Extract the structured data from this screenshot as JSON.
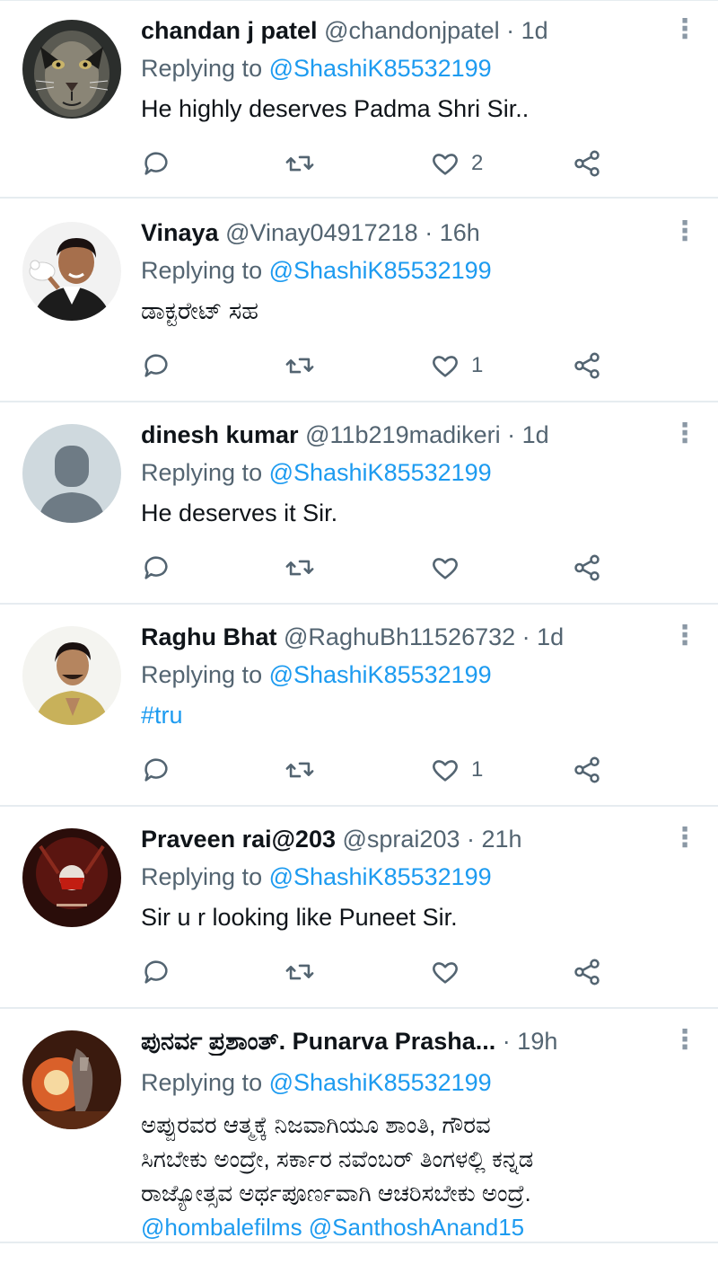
{
  "tweets": [
    {
      "name": "chandan j patel",
      "handle": "@chandonjpatel",
      "time": "1d",
      "replying_label": "Replying to ",
      "mention": "@ShashiK85532199",
      "text": "He highly deserves Padma Shri Sir..",
      "likes": "2",
      "avatar": "tiger-face"
    },
    {
      "name": "Vinaya",
      "handle": "@Vinay04917218",
      "time": "16h",
      "replying_label": "Replying to ",
      "mention": "@ShashiK85532199",
      "text": "ಡಾಕ್ಟರೇಟ್ ಸಹ",
      "likes": "1",
      "avatar": "man-with-dove"
    },
    {
      "name": "dinesh kumar",
      "handle": "@11b219madikeri",
      "time": "1d",
      "replying_label": "Replying to ",
      "mention": "@ShashiK85532199",
      "text": "He deserves it Sir.",
      "likes": "",
      "avatar": "default-person"
    },
    {
      "name": "Raghu Bhat",
      "handle": "@RaghuBh11526732",
      "time": "1d",
      "replying_label": "Replying to ",
      "mention": "@ShashiK85532199",
      "text": "#tru",
      "likes": "1",
      "avatar": "man-namaste"
    },
    {
      "name": "Praveen rai@203",
      "handle": "@sprai203",
      "time": "21h",
      "replying_label": "Replying to ",
      "mention": "@ShashiK85532199",
      "text": "Sir u r looking like Puneet Sir.",
      "likes": "",
      "avatar": "dark-red-poster"
    },
    {
      "name": "ಪುನರ್ವ ಪ್ರಶಾಂತ್. Punarva Prasha...",
      "handle": "",
      "time": "19h",
      "replying_label": "Replying to ",
      "mention": "@ShashiK85532199",
      "text_lines": [
        "ಅಪ್ಪುರವರ ಆತ್ಮಕ್ಕೆ ನಿಜವಾಗಿಯೂ ಶಾಂತಿ, ಗೌರವ",
        "ಸಿಗಬೇಕು ಅಂದ್ರೇ, ಸರ್ಕಾರ ನವೆಂಬರ್ ತಿಂಗಳಲ್ಲಿ ಕನ್ನಡ",
        "ರಾಜ್ಯೋತ್ಸವ ಅರ್ಥಪೂರ್ಣವಾಗಿ ಆಚರಿಸಬೇಕು ಅಂದ್ರೆ.",
        "@hombalefilms  @SanthoshAnand15"
      ],
      "avatar": "fiery-statue"
    }
  ],
  "ui": {
    "dot": " · ",
    "more_glyph": "⋮",
    "icons": [
      "reply-icon",
      "retweet-icon",
      "like-icon",
      "share-icon"
    ]
  }
}
